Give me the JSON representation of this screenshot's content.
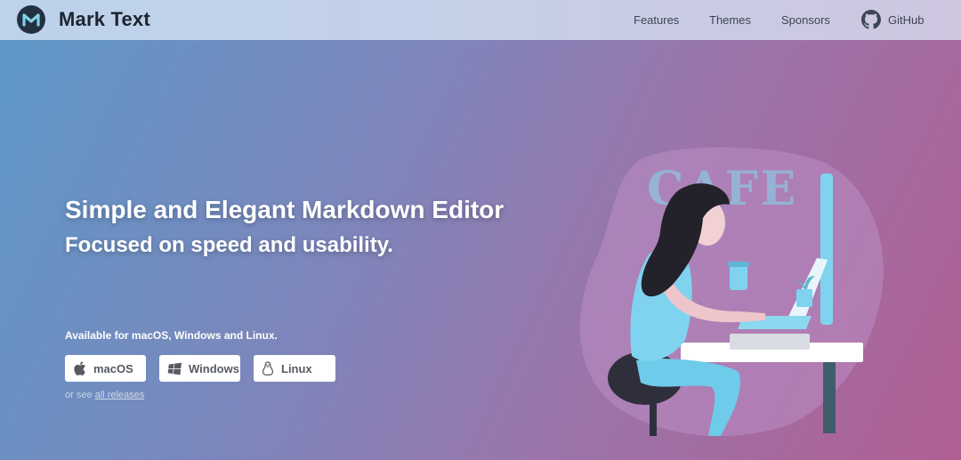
{
  "header": {
    "brand": "Mark Text",
    "nav": [
      "Features",
      "Themes",
      "Sponsors",
      "GitHub"
    ]
  },
  "hero": {
    "title": "Simple and Elegant Markdown Editor",
    "subtitle": "Focused on speed and usability.",
    "available": "Available for macOS, Windows and Linux.",
    "buttons": [
      {
        "label": "macOS",
        "icon": "apple-icon"
      },
      {
        "label": "Windows",
        "icon": "windows-icon"
      },
      {
        "label": "Linux",
        "icon": "linux-penguin-icon"
      }
    ],
    "or_see": "or see",
    "releases_link": "all releases",
    "illustration_sign": "CAFE"
  },
  "colors": {
    "accent_dark": "#233140",
    "gradient_start": "#5c98c8",
    "gradient_end": "#b05f92",
    "button_text": "#555a63"
  }
}
